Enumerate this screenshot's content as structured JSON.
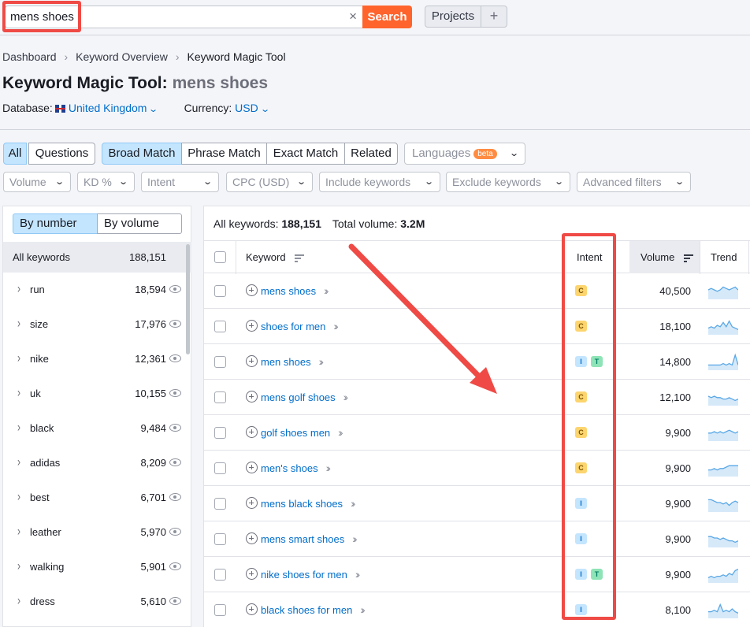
{
  "search": {
    "value": "mens shoes",
    "button": "Search",
    "clear_icon": "×"
  },
  "header": {
    "projects_label": "Projects",
    "plus_label": "+"
  },
  "breadcrumb": [
    "Dashboard",
    "Keyword Overview",
    "Keyword Magic Tool"
  ],
  "page": {
    "title": "Keyword Magic Tool:",
    "keyword": "mens shoes",
    "database_label": "Database:",
    "database_value": "United Kingdom",
    "currency_label": "Currency:",
    "currency_value": "USD"
  },
  "match_tabs": [
    "All",
    "Questions",
    "Broad Match",
    "Phrase Match",
    "Exact Match",
    "Related"
  ],
  "languages": {
    "label": "Languages",
    "badge": "beta"
  },
  "filters": [
    "Volume",
    "KD %",
    "Intent",
    "CPC (USD)",
    "Include keywords",
    "Exclude keywords",
    "Advanced filters"
  ],
  "left_panel": {
    "toggle_on": "By number",
    "toggle_off": "By volume",
    "all_label": "All keywords",
    "all_count": "188,151",
    "groups": [
      {
        "label": "run",
        "count": "18,594"
      },
      {
        "label": "size",
        "count": "17,976"
      },
      {
        "label": "nike",
        "count": "12,361"
      },
      {
        "label": "uk",
        "count": "10,155"
      },
      {
        "label": "black",
        "count": "9,484"
      },
      {
        "label": "adidas",
        "count": "8,209"
      },
      {
        "label": "best",
        "count": "6,701"
      },
      {
        "label": "leather",
        "count": "5,970"
      },
      {
        "label": "walking",
        "count": "5,901"
      },
      {
        "label": "dress",
        "count": "5,610"
      }
    ]
  },
  "summary": {
    "all_label": "All keywords:",
    "all_value": "188,151",
    "volume_label": "Total volume:",
    "volume_value": "3.2M"
  },
  "table": {
    "headers": {
      "keyword": "Keyword",
      "intent": "Intent",
      "volume": "Volume",
      "trend": "Trend"
    },
    "rows": [
      {
        "keyword": "mens shoes",
        "intent": [
          "C"
        ],
        "volume": "40,500",
        "trend": [
          5,
          6,
          5,
          4,
          5,
          7,
          6,
          5,
          6,
          7,
          5
        ]
      },
      {
        "keyword": "shoes for men",
        "intent": [
          "C"
        ],
        "volume": "18,100",
        "trend": [
          3,
          4,
          3,
          5,
          4,
          7,
          4,
          8,
          4,
          3,
          2
        ]
      },
      {
        "keyword": "men shoes",
        "intent": [
          "I",
          "T"
        ],
        "volume": "14,800",
        "trend": [
          2,
          2,
          2,
          2,
          2,
          3,
          2,
          3,
          2,
          9,
          2
        ]
      },
      {
        "keyword": "mens golf shoes",
        "intent": [
          "C"
        ],
        "volume": "12,100",
        "trend": [
          5,
          4,
          5,
          4,
          4,
          3,
          3,
          4,
          3,
          2,
          3
        ]
      },
      {
        "keyword": "golf shoes men",
        "intent": [
          "C"
        ],
        "volume": "9,900",
        "trend": [
          4,
          4,
          5,
          4,
          5,
          4,
          5,
          6,
          5,
          4,
          5
        ]
      },
      {
        "keyword": "men's shoes",
        "intent": [
          "C"
        ],
        "volume": "9,900",
        "trend": [
          3,
          3,
          4,
          3,
          4,
          4,
          5,
          6,
          6,
          6,
          6
        ]
      },
      {
        "keyword": "mens black shoes",
        "intent": [
          "I"
        ],
        "volume": "9,900",
        "trend": [
          7,
          7,
          6,
          5,
          5,
          4,
          5,
          3,
          5,
          6,
          5
        ]
      },
      {
        "keyword": "mens smart shoes",
        "intent": [
          "I"
        ],
        "volume": "9,900",
        "trend": [
          6,
          6,
          5,
          5,
          4,
          5,
          4,
          3,
          3,
          2,
          3
        ]
      },
      {
        "keyword": "nike shoes for men",
        "intent": [
          "I",
          "T"
        ],
        "volume": "9,900",
        "trend": [
          2,
          3,
          2,
          3,
          3,
          4,
          3,
          5,
          4,
          7,
          8
        ]
      },
      {
        "keyword": "black shoes for men",
        "intent": [
          "I"
        ],
        "volume": "8,100",
        "trend": [
          3,
          3,
          4,
          3,
          8,
          3,
          4,
          3,
          5,
          3,
          2
        ]
      }
    ]
  },
  "colors": {
    "accent": "#ff642d",
    "link": "#006dca",
    "annotation": "#ef4a45",
    "trend": "#5aa8e6"
  }
}
